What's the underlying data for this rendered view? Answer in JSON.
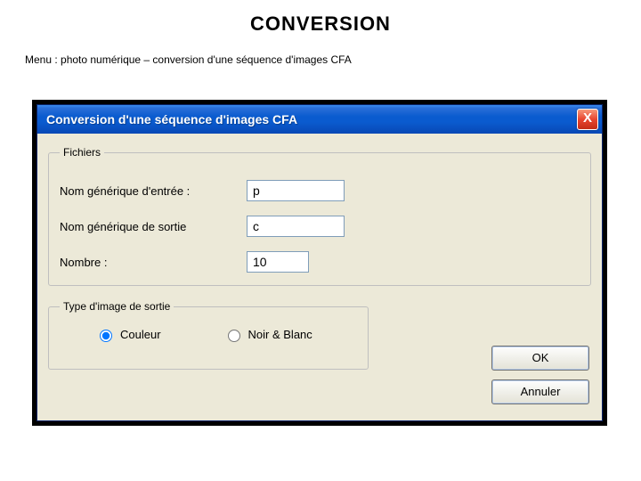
{
  "slide": {
    "title": "CONVERSION",
    "menu_path": "Menu : photo numérique – conversion d'une séquence d'images CFA"
  },
  "window": {
    "title": "Conversion d'une séquence d'images CFA",
    "close_icon": "X"
  },
  "fieldsets": {
    "files_legend": "Fichiers",
    "output_legend": "Type d'image de sortie"
  },
  "labels": {
    "input_name": "Nom générique d'entrée :",
    "output_name": "Nom générique de sortie",
    "count": "Nombre :"
  },
  "values": {
    "input_name": "p",
    "output_name": "c",
    "count": "10"
  },
  "radios": {
    "color": "Couleur",
    "bw": "Noir & Blanc",
    "selected": "color"
  },
  "buttons": {
    "ok": "OK",
    "cancel": "Annuler"
  }
}
